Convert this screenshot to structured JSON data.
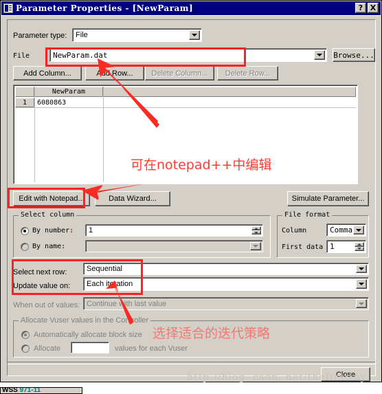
{
  "window": {
    "title": "Parameter Properties - [NewParam]",
    "icon": "document-icon",
    "help_button": "?",
    "close_button": "X"
  },
  "parameter_type": {
    "label": "Parameter type:",
    "value": "File"
  },
  "file": {
    "label": "File",
    "value": "NewParam.dat",
    "browse_button": "Browse..."
  },
  "table_buttons": {
    "add_column": "Add Column...",
    "add_row": "Add Row...",
    "delete_column": "Delete Column...",
    "delete_row": "Delete Row..."
  },
  "grid": {
    "columns": [
      "NewParam",
      ""
    ],
    "rows": [
      {
        "index": "1",
        "values": [
          "6080863",
          ""
        ]
      }
    ]
  },
  "action_buttons": {
    "edit_with_notepad": "Edit with Notepad...",
    "data_wizard": "Data Wizard...",
    "simulate_parameter": "Simulate Parameter..."
  },
  "select_column": {
    "title": "Select column",
    "by_number_label": "By number:",
    "by_number_value": "1",
    "by_name_label": "By name:",
    "by_name_value": ""
  },
  "file_format": {
    "title": "File format",
    "column_label": "Column",
    "column_value": "Comma",
    "first_data_label": "First data",
    "first_data_value": "1"
  },
  "row_options": {
    "select_next_row_label": "Select next row:",
    "select_next_row_value": "Sequential",
    "update_value_on_label": "Update value on:",
    "update_value_on_value": "Each iteration",
    "when_out_of_values_label": "When out of values:",
    "when_out_of_values_value": "Continue with last value"
  },
  "allocate": {
    "title": "Allocate Vuser values in the Controller",
    "auto_label": "Automatically allocate block size",
    "manual_label_pre": "Allocate",
    "manual_value": "",
    "manual_label_post": "values for each Vuser"
  },
  "footer": {
    "close_button": "Close"
  },
  "annotations": {
    "note_notepad": "可在notepad++中编辑",
    "note_strategy": "选择适合的迭代策略",
    "watermark": "http://blog. csdn. net/thefirstray"
  },
  "bottom_strip": {
    "text_a": "WSS ",
    "text_b": "971-11"
  },
  "colors": {
    "title_bar": "#00007e",
    "face": "#d4d0c8",
    "annotation_red": "#ff3b30",
    "annotation_box": "#ff2020",
    "annotation_faded": "#f07a72"
  }
}
